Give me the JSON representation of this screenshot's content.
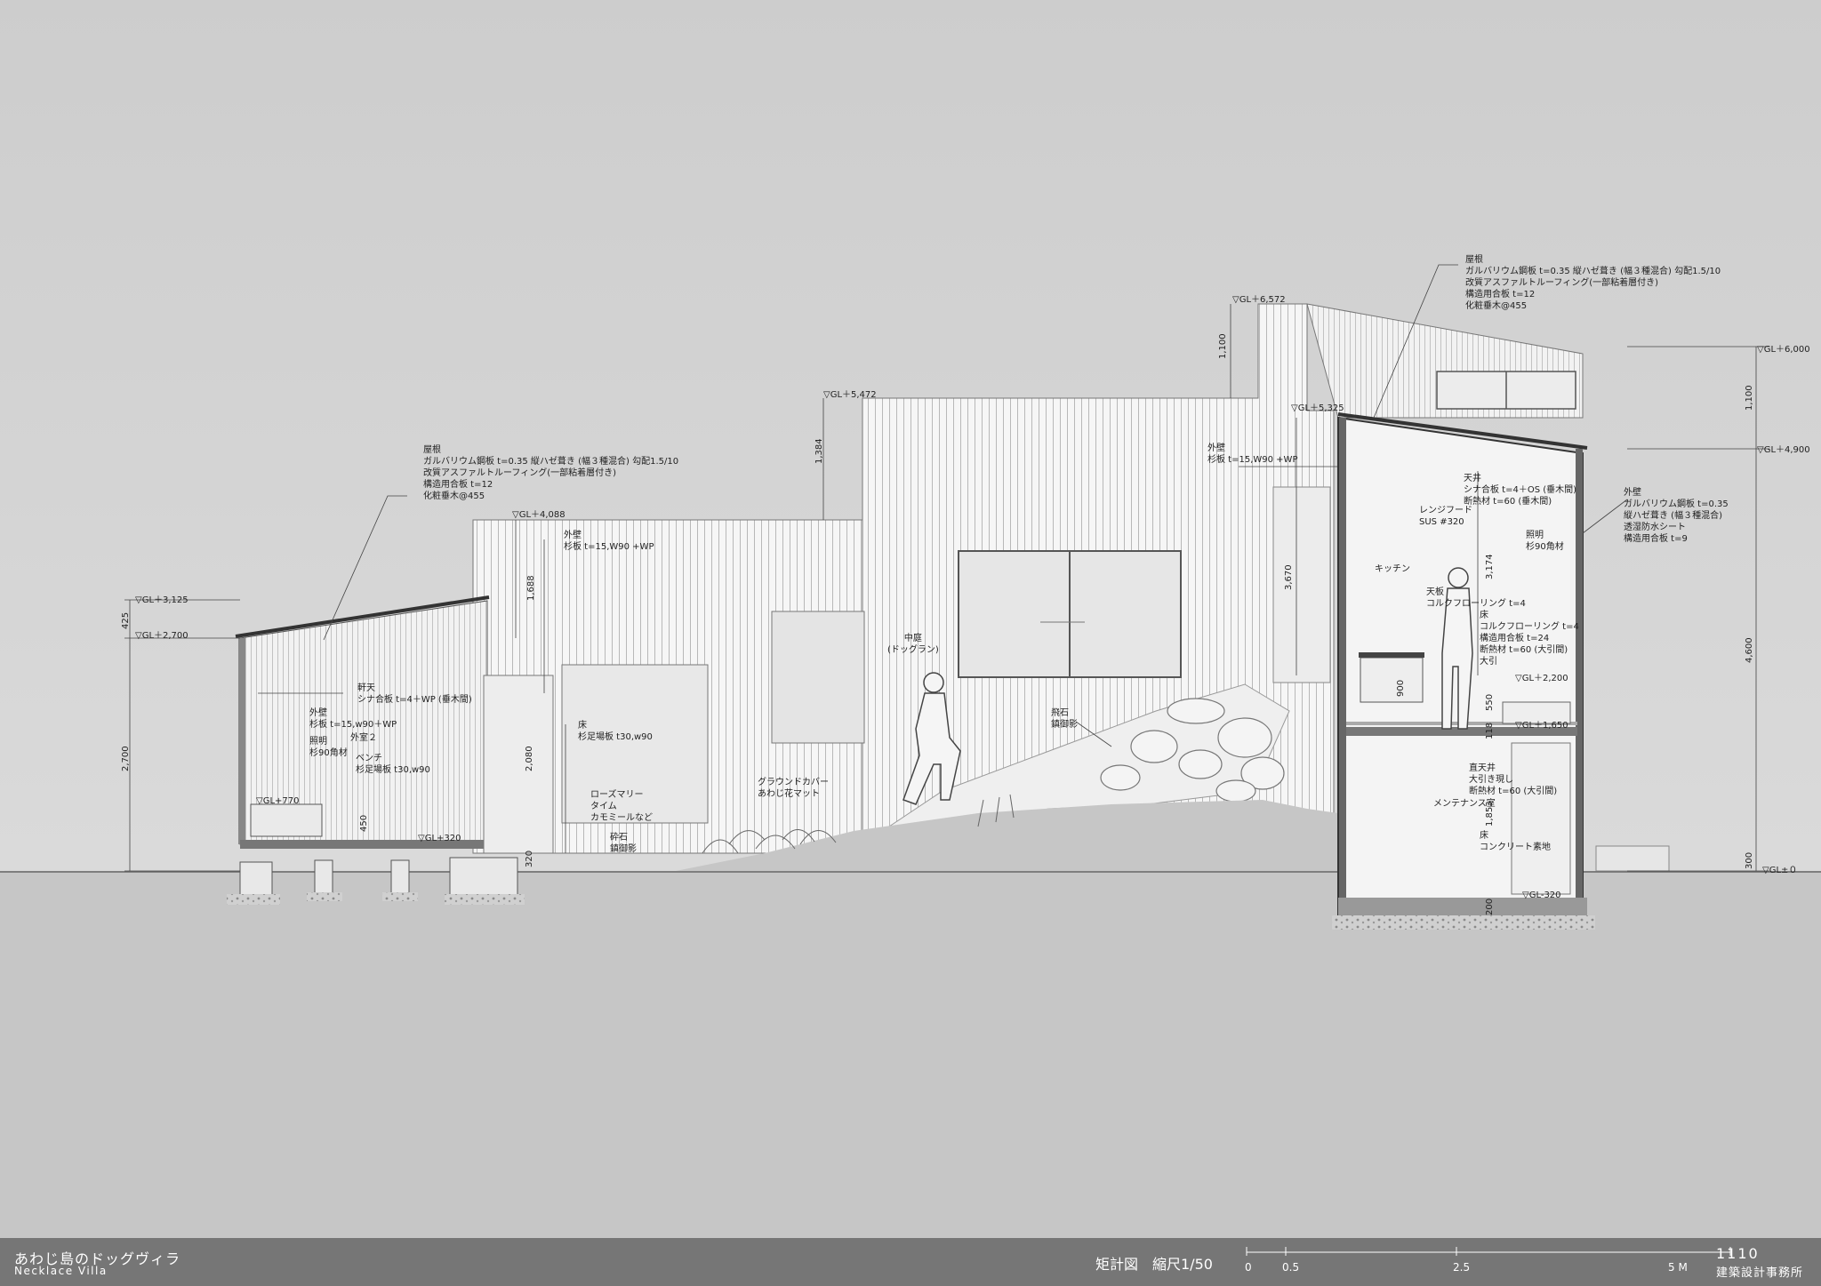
{
  "levels": {
    "gl_6572": "▽GL＋6,572",
    "gl_6000": "▽GL＋6,000",
    "gl_5472": "▽GL＋5,472",
    "gl_5325": "▽GL＋5,325",
    "gl_4900": "▽GL＋4,900",
    "gl_4088": "▽GL＋4,088",
    "gl_3125": "▽GL＋3,125",
    "gl_2700": "▽GL＋2,700",
    "gl_2200": "▽GL＋2,200",
    "gl_1650": "▽GL＋1,650",
    "gl_770": "▽GL+770",
    "gl_320": "▽GL+320",
    "gl_0": "▽GL±０",
    "gl_m320": "▽GL-320"
  },
  "dims": {
    "d425": "425",
    "d2700": "2,700",
    "d1688": "1,688",
    "d1384": "1,384",
    "d1100a": "1,100",
    "d1100b": "1,100",
    "d3670": "3,670",
    "d3174": "3,174",
    "d4600": "4,600",
    "d2080": "2,080",
    "d450": "450",
    "d320": "320",
    "d900": "900",
    "d550": "550",
    "d118": "118",
    "d1853": "1,853",
    "d300": "300",
    "d200": "200"
  },
  "notes": {
    "roof_left": [
      "屋根",
      "ガルバリウム鋼板 t=0.35 縦ハゼ葺き (幅３種混合) 勾配1.5/10",
      "改質アスファルトルーフィング(一部粘着層付き)",
      "構造用合板 t=12",
      "化粧垂木@455"
    ],
    "roof_right": [
      "屋根",
      "ガルバリウム鋼板 t=0.35 縦ハゼ葺き (幅３種混合) 勾配1.5/10",
      "改質アスファルトルーフィング(一部粘着層付き)",
      "構造用合板 t=12",
      "化粧垂木@455"
    ],
    "ext_wall_mid": [
      "外壁",
      "杉板 t=15,W90 +WP"
    ],
    "ext_wall_right": [
      "外壁",
      "杉板 t=15,W90 +WP"
    ],
    "ext_wall_far": [
      "外壁",
      "ガルバリウム鋼板 t=0.35",
      "縦ハゼ葺き (幅３種混合)",
      "透湿防水シート",
      "構造用合板 t=9"
    ],
    "soffit": [
      "軒天",
      "シナ合板 t=4＋WP (垂木間)"
    ],
    "ext_wall_left": [
      "外壁",
      "杉板 t=15,w90＋WP"
    ],
    "outdoor2": [
      "外室２"
    ],
    "light_left": [
      "照明",
      "杉90角材"
    ],
    "bench": [
      "ベンチ",
      "杉足場板 t30,w90"
    ],
    "floor_mid": [
      "床",
      "杉足場板 t30,w90"
    ],
    "herbs": [
      "ローズマリー",
      "タイム",
      "カモミールなど"
    ],
    "gravel": [
      "砕石",
      "鎮御影"
    ],
    "groundcover": [
      "グラウンドカバー",
      "あわじ花マット"
    ],
    "courtyard": [
      "中庭",
      "(ドッグラン)"
    ],
    "stepping": [
      "飛石",
      "鎮御影"
    ],
    "ceiling": [
      "天井",
      "シナ合板 t=4＋OS (垂木間)",
      "断熱材 t=60 (垂木間)"
    ],
    "range_hood": [
      "レンジフード",
      "SUS #320"
    ],
    "light_right": [
      "照明",
      "杉90角材"
    ],
    "kitchen": [
      "キッチン"
    ],
    "counter": [
      "天板",
      "コルクフローリング t=4"
    ],
    "floor_right": [
      "床",
      "コルクフローリング t=4",
      "構造用合板 t=24",
      "断熱材 t=60 (大引間)",
      "大引"
    ],
    "ceiling_direct": [
      "直天井",
      "大引き現し",
      "断熱材 t=60 (大引間)"
    ],
    "maintenance": [
      "メンテナンス室"
    ],
    "floor_conc": [
      "床",
      "コンクリート素地"
    ]
  },
  "footer": {
    "title_jp": "あわじ島のドッグヴィラ",
    "title_en": "Necklace Villa",
    "drawing_title": "矩計図　縮尺1/50",
    "scale_0": "0",
    "scale_05": "0.5",
    "scale_25": "2.5",
    "scale_5": "5 M",
    "number": "1110",
    "firm": "建築設計事務所"
  },
  "colors": {
    "sky": "#d6d6d6",
    "ground": "#c4c4c4",
    "footer": "#767676",
    "line": "#555555"
  }
}
